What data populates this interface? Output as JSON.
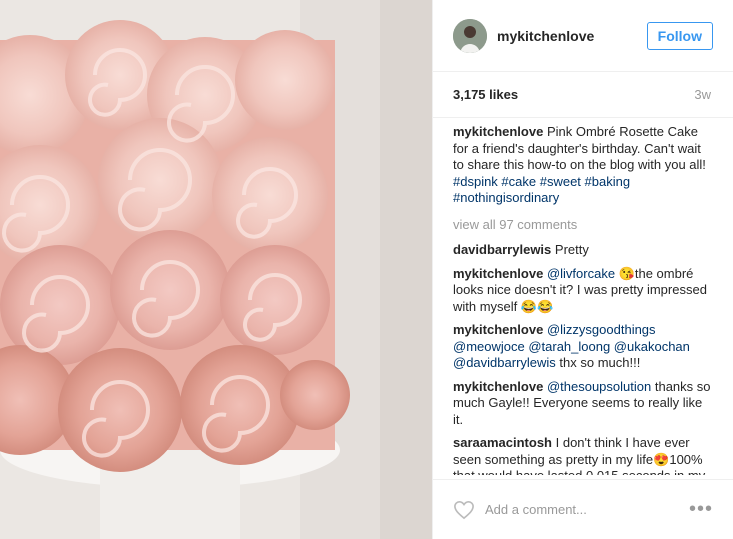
{
  "post": {
    "username": "mykitchenlove",
    "follow_label": "Follow",
    "likes": "3,175 likes",
    "time_ago": "3w"
  },
  "caption": {
    "user": "mykitchenlove",
    "text": "Pink Ombré Rosette Cake for a friend's daughter's birthday. Can't wait to share this how-to on the blog with you all!",
    "hashtags": "#dspink #cake #sweet #baking #nothingisordinary"
  },
  "view_all": "view all 97 comments",
  "comments": [
    {
      "user": "davidbarrylewis",
      "mentions": "",
      "text": "Pretty"
    },
    {
      "user": "mykitchenlove",
      "mentions": "@livforcake",
      "text": "😘the ombré looks nice doesn't it? I was pretty impressed with myself 😂😂"
    },
    {
      "user": "mykitchenlove",
      "mentions": "@lizzysgoodthings @meowjoce @tarah_loong @ukakochan @davidbarrylewis",
      "text": "thx so much!!!"
    },
    {
      "user": "mykitchenlove",
      "mentions": "@thesoupsolution",
      "text": "thanks so much Gayle!! Everyone seems to really like it."
    },
    {
      "user": "saraamacintosh",
      "mentions": "",
      "text": "I don't think I have ever seen something as pretty in my life😍100% that would have lasted 0.015 seconds in mv"
    }
  ],
  "footer": {
    "add_comment_placeholder": "Add a comment...",
    "more_label": "•••"
  }
}
